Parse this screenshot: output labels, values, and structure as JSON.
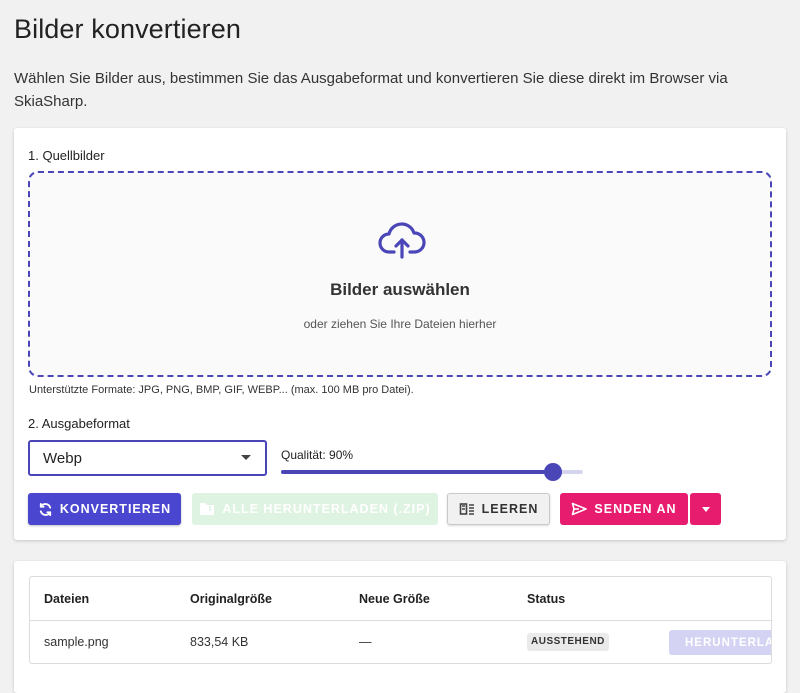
{
  "page": {
    "title": "Bilder konvertieren",
    "intro": "Wählen Sie Bilder aus, bestimmen Sie das Ausgabeformat und konvertieren Sie diese direkt im Browser via SkiaSharp."
  },
  "source": {
    "section_label": "1. Quellbilder",
    "dropzone_title": "Bilder auswählen",
    "dropzone_subtitle": "oder ziehen Sie Ihre Dateien hierher",
    "upload_icon": "cloud-upload-icon",
    "formats_hint": "Unterstützte Formate: JPG, PNG, BMP, GIF, WEBP... (max. 100 MB pro Datei)."
  },
  "output": {
    "section_label": "2. Ausgabeformat",
    "format_value": "Webp",
    "quality_label": "Qualität: 90%",
    "quality_value": 90
  },
  "actions": {
    "convert_label": "KONVERTIEREN",
    "zip_label": "ALLE HERUNTERLADEN (.ZIP)",
    "clear_label": "LEEREN",
    "send_label": "SENDEN AN"
  },
  "table": {
    "headers": [
      "Dateien",
      "Originalgröße",
      "Neue Größe",
      "Status"
    ],
    "rows": [
      {
        "file": "sample.png",
        "original_size": "833,54 KB",
        "new_size": "—",
        "status": "AUSSTEHEND",
        "download_label": "HERUNTERLADEN"
      }
    ]
  },
  "colors": {
    "primary": "#4a46d0",
    "accent": "#e81c6e",
    "success_disabled": "#dff3e2",
    "page_bg": "#f1f1f2"
  }
}
